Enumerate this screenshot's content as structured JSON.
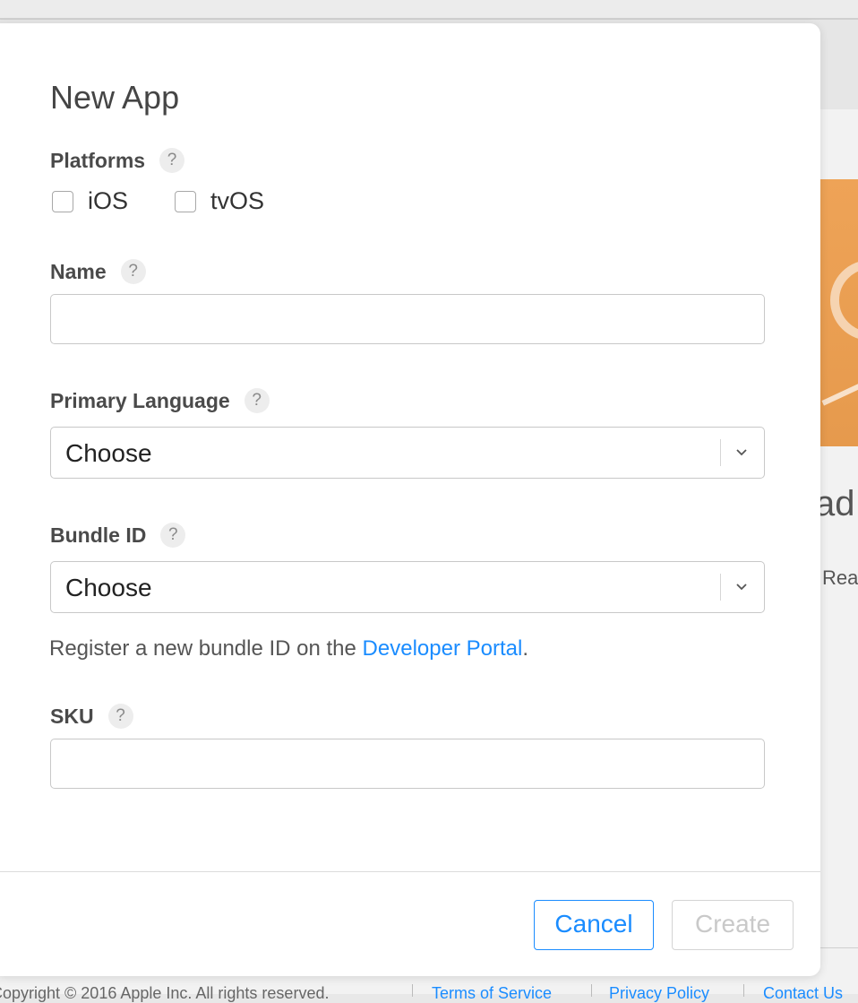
{
  "background": {
    "heading_fragment": "ad",
    "subtext_fragment": "Rea",
    "footer": {
      "copyright": "Copyright © 2016 Apple Inc. All rights reserved.",
      "links": [
        "Terms of Service",
        "Privacy Policy",
        "Contact Us"
      ]
    }
  },
  "modal": {
    "title": "New App",
    "platforms": {
      "label": "Platforms",
      "options": [
        {
          "label": "iOS",
          "checked": false
        },
        {
          "label": "tvOS",
          "checked": false
        }
      ]
    },
    "name": {
      "label": "Name",
      "value": ""
    },
    "primary_language": {
      "label": "Primary Language",
      "selected": "Choose"
    },
    "bundle_id": {
      "label": "Bundle ID",
      "selected": "Choose",
      "helper_prefix": "Register a new bundle ID on the ",
      "helper_link": "Developer Portal",
      "helper_suffix": "."
    },
    "sku": {
      "label": "SKU",
      "value": ""
    },
    "help_glyph": "?",
    "buttons": {
      "cancel": "Cancel",
      "create": "Create"
    }
  },
  "icons": {
    "help": "question-mark-circle",
    "dropdown": "chevron-down"
  },
  "colors": {
    "accent": "#1a8cff",
    "disabled": "#c9c9c9",
    "promo": "#e69a4d"
  }
}
